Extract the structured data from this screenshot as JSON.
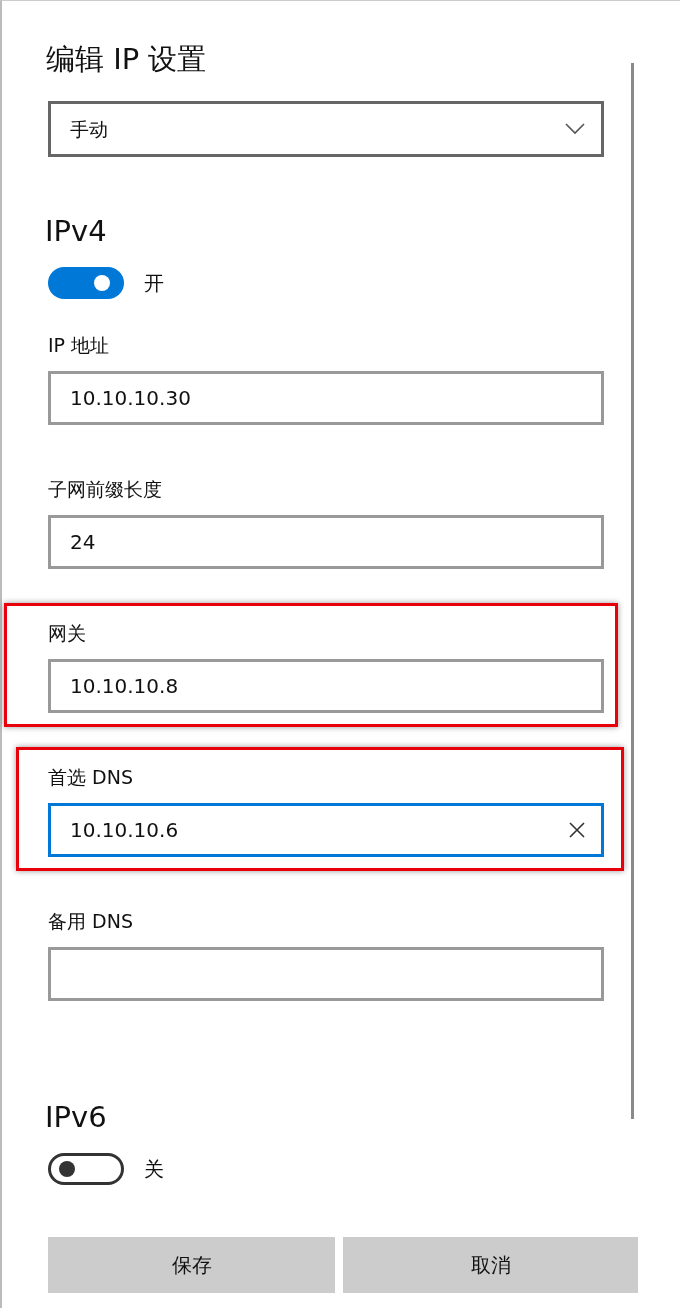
{
  "title": "编辑 IP 设置",
  "mode_dropdown": {
    "value": "手动"
  },
  "sections": [
    {
      "heading": "IPv4",
      "toggle": {
        "on": true,
        "label": "开"
      },
      "fields": [
        {
          "label": "IP 地址",
          "value": "10.10.10.30",
          "focused": false,
          "highlighted": false
        },
        {
          "label": "子网前缀长度",
          "value": "24",
          "focused": false,
          "highlighted": false
        },
        {
          "label": "网关",
          "value": "10.10.10.8",
          "focused": false,
          "highlighted": true
        },
        {
          "label": "首选 DNS",
          "value": "10.10.10.6",
          "focused": true,
          "highlighted": true
        },
        {
          "label": "备用 DNS",
          "focused": false,
          "highlighted": false
        }
      ]
    },
    {
      "heading": "IPv6",
      "toggle": {
        "on": false,
        "label": "关"
      }
    }
  ],
  "buttons": [
    "保存",
    "取消"
  ]
}
